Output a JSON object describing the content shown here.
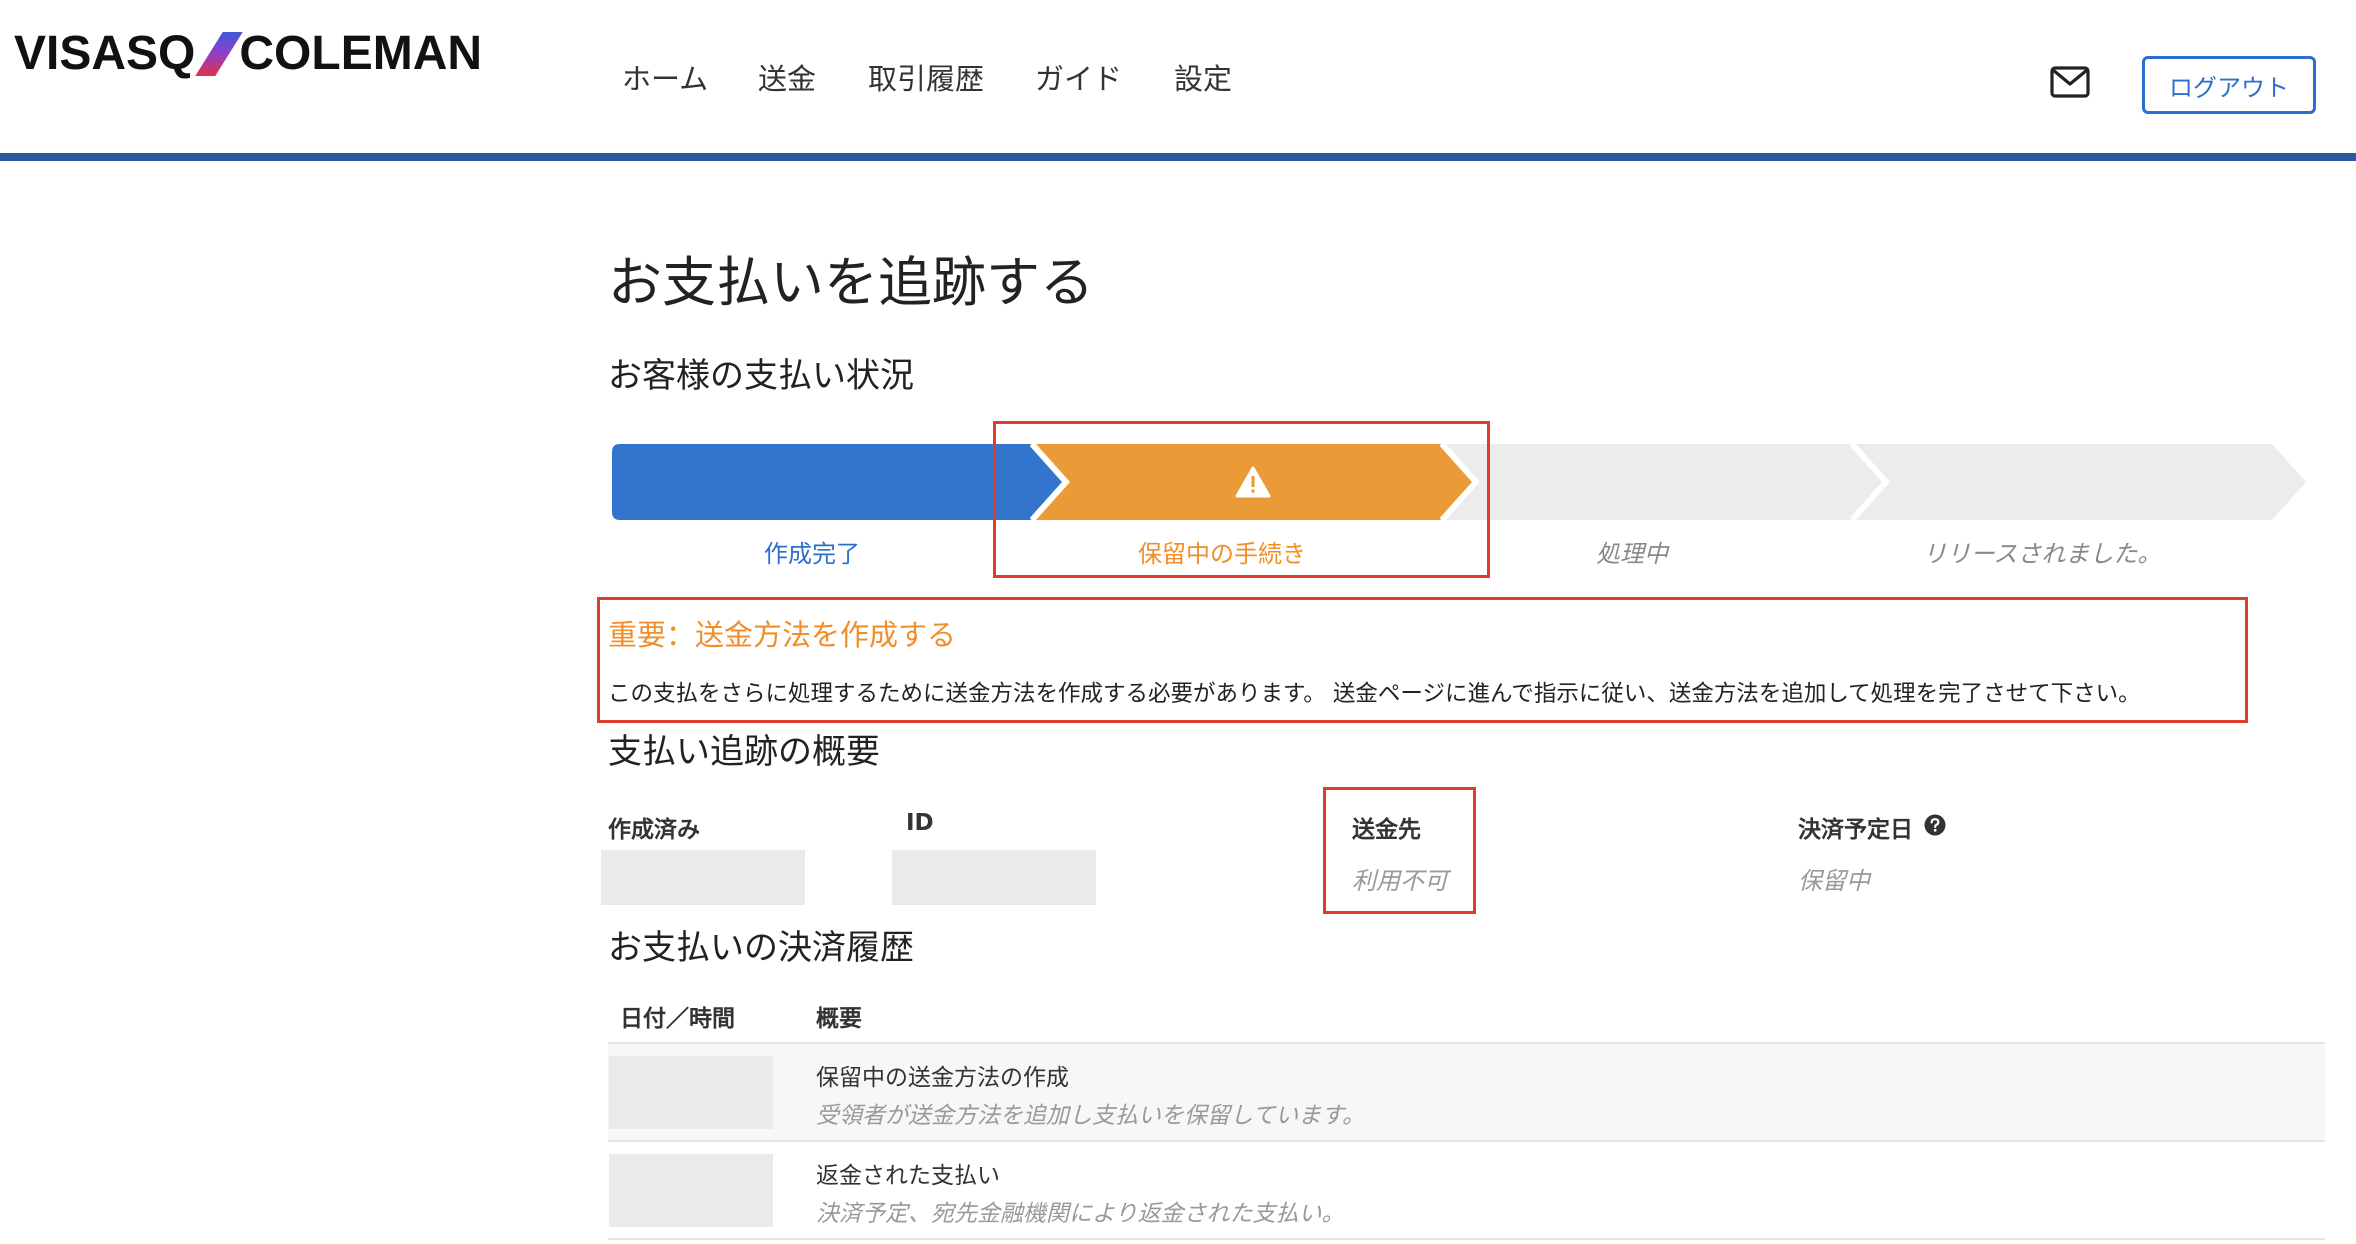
{
  "brand": {
    "left": "VISASQ",
    "right": "COLEMAN"
  },
  "nav": {
    "items": [
      "ホーム",
      "送金",
      "取引履歴",
      "ガイド",
      "設定"
    ],
    "logout_label": "ログアウト",
    "mail_icon": "envelope-icon"
  },
  "page": {
    "title": "お支払いを追跡する"
  },
  "status": {
    "heading": "お客様の支払い状況",
    "steps": [
      {
        "label": "作成完了",
        "state": "complete",
        "color": "#3374cc"
      },
      {
        "label": "保留中の手続き",
        "state": "pending",
        "color": "#ea9a37",
        "icon": "warning-icon"
      },
      {
        "label": "処理中",
        "state": "inactive",
        "color": "#ececec"
      },
      {
        "label": "リリースされました。",
        "state": "inactive",
        "color": "#ececec"
      }
    ]
  },
  "notice": {
    "title": "重要：送金方法を作成する",
    "body": "この支払をさらに処理するために送金方法を作成する必要があります。 送金ページに進んで指示に従い、送金方法を追加して処理を完了させて下さい。"
  },
  "summary": {
    "heading": "支払い追跡の概要",
    "created_label": "作成済み",
    "id_label": "ID",
    "recipient_label": "送金先",
    "recipient_value": "利用不可",
    "settlement_label": "決済予定日",
    "settlement_value": "保留中",
    "help_icon": "question-circle-icon"
  },
  "history": {
    "heading": "お支払いの決済履歴",
    "columns": [
      "日付／時間",
      "概要"
    ],
    "rows": [
      {
        "title": "保留中の送金方法の作成",
        "subtitle": "受領者が送金方法を追加し支払いを保留しています。"
      },
      {
        "title": "返金された支払い",
        "subtitle": "決済予定、宛先金融機関により返金された支払い。"
      }
    ]
  },
  "colors": {
    "accent_blue": "#2c6fcc",
    "header_rule": "#2c5aa0",
    "pending_orange": "#ea9a37",
    "highlight_red": "#e03b2b"
  }
}
